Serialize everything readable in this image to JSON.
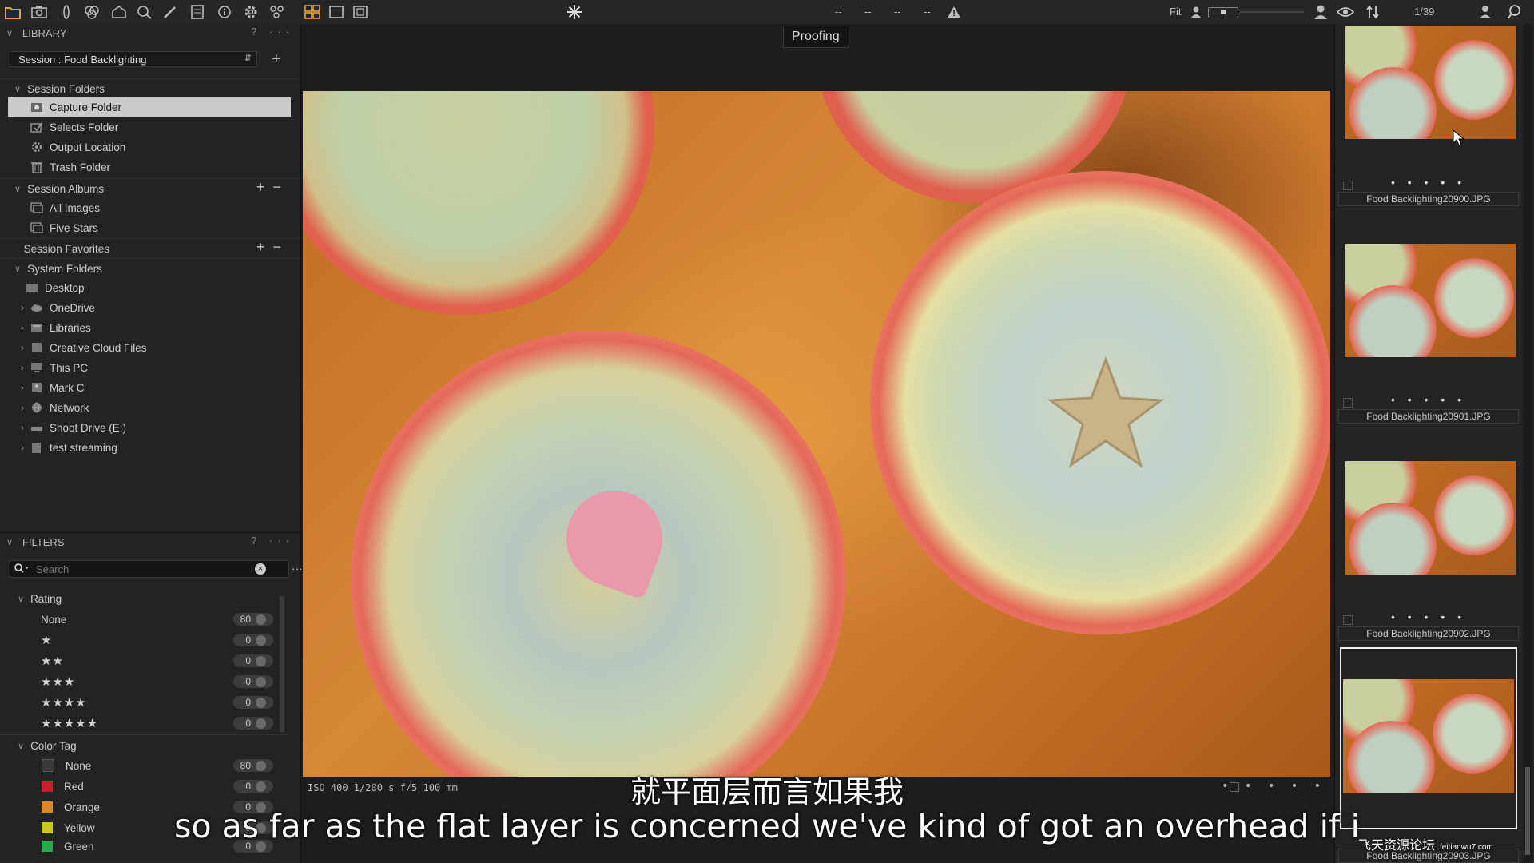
{
  "toolbar": {
    "center_icon": "asterisk-icon",
    "fit_label": "Fit",
    "dashes": [
      "--",
      "--",
      "--",
      "--"
    ],
    "counter": "1/39"
  },
  "library": {
    "title": "LIBRARY",
    "help": "?",
    "session_select": "Session : Food Backlighting",
    "session_folders_title": "Session Folders",
    "session_folders": [
      {
        "label": "Capture Folder",
        "icon": "capture-folder-icon",
        "selected": true
      },
      {
        "label": "Selects Folder",
        "icon": "selects-folder-icon"
      },
      {
        "label": "Output Location",
        "icon": "output-gear-icon"
      },
      {
        "label": "Trash Folder",
        "icon": "trash-icon"
      }
    ],
    "session_albums_title": "Session Albums",
    "session_albums": [
      {
        "label": "All Images",
        "icon": "album-icon"
      },
      {
        "label": "Five Stars",
        "icon": "album-icon"
      }
    ],
    "session_favorites_title": "Session Favorites",
    "system_folders_title": "System Folders",
    "system_folders": [
      {
        "label": "Desktop",
        "icon": "desktop-folder-icon"
      },
      {
        "label": "OneDrive",
        "icon": "cloud-icon"
      },
      {
        "label": "Libraries",
        "icon": "libraries-icon"
      },
      {
        "label": "Creative Cloud Files",
        "icon": "creative-cloud-icon"
      },
      {
        "label": "This PC",
        "icon": "pc-icon"
      },
      {
        "label": "Mark C",
        "icon": "user-folder-icon"
      },
      {
        "label": "Network",
        "icon": "network-icon"
      },
      {
        "label": "Shoot Drive (E:)",
        "icon": "drive-icon"
      },
      {
        "label": "test streaming",
        "icon": "folder-icon"
      }
    ]
  },
  "filters": {
    "title": "FILTERS",
    "help": "?",
    "search_placeholder": "Search",
    "rating_title": "Rating",
    "rating_none": "None",
    "ratings": [
      {
        "stars": 0,
        "count": "80"
      },
      {
        "stars": 1,
        "count": "0"
      },
      {
        "stars": 2,
        "count": "0"
      },
      {
        "stars": 3,
        "count": "0"
      },
      {
        "stars": 4,
        "count": "0"
      },
      {
        "stars": 5,
        "count": "0"
      }
    ],
    "color_tag_title": "Color Tag",
    "color_tags": [
      {
        "label": "None",
        "count": "80",
        "color": "#3a3a3a"
      },
      {
        "label": "Red",
        "count": "0",
        "color": "#c8202a"
      },
      {
        "label": "Orange",
        "count": "0",
        "color": "#d88a2a"
      },
      {
        "label": "Yellow",
        "count": "0",
        "color": "#c8c820"
      },
      {
        "label": "Green",
        "count": "0",
        "color": "#2aa84a"
      }
    ]
  },
  "viewer": {
    "proofing_label": "Proofing",
    "exif": "ISO 400  1/200 s  f/5  100 mm",
    "rating_dots": "• • • • •"
  },
  "filmstrip": {
    "items": [
      {
        "name": "Food Backlighting20900.JPG",
        "dots": "• • • • •",
        "selected": false
      },
      {
        "name": "Food Backlighting20901.JPG",
        "dots": "• • • • •",
        "selected": false
      },
      {
        "name": "Food Backlighting20902.JPG",
        "dots": "• • • • •",
        "selected": false
      },
      {
        "name": "Food Backlighting20903.JPG",
        "dots": "",
        "selected": true
      }
    ]
  },
  "subtitles": {
    "chinese": "就平面层而言如果我",
    "english": "so as far as the flat layer is concerned we've kind of got an overhead if i"
  },
  "watermark": {
    "text": "飞天资源论坛",
    "url": "feitianwu7.com"
  },
  "colors": {
    "accent_orange": "#e9a23b",
    "selected_row": "#cacaca",
    "panel_bg": "#232323"
  }
}
